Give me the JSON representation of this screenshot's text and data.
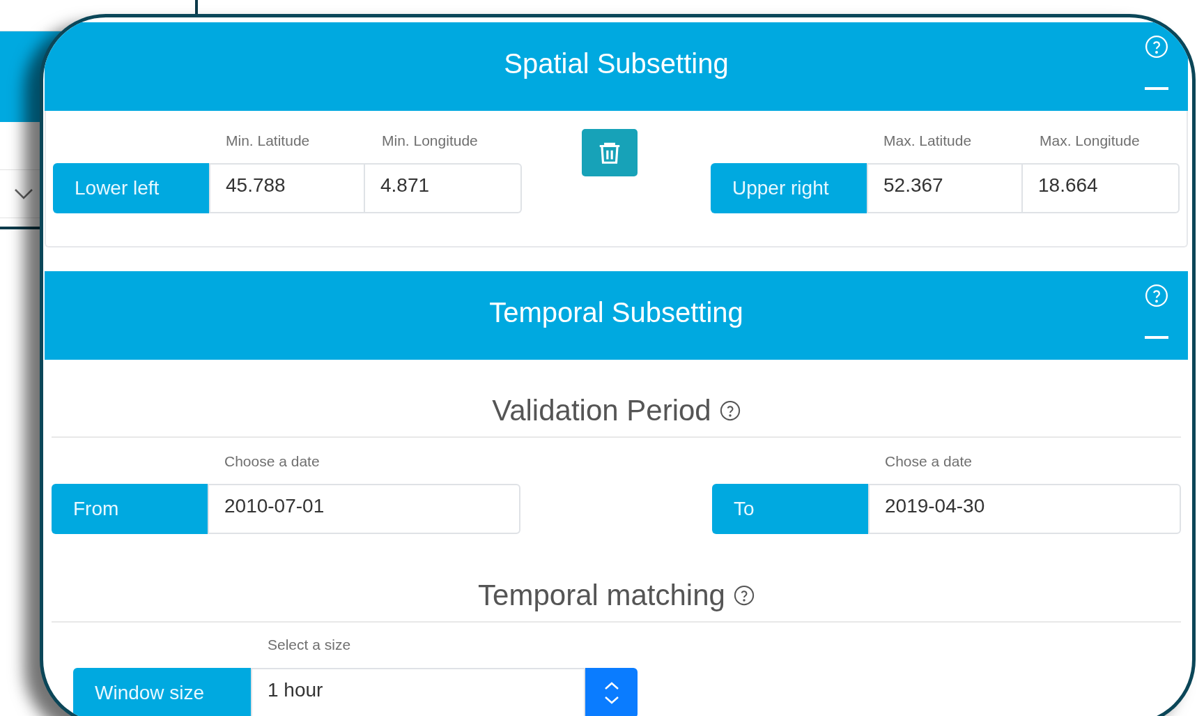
{
  "spatial_subsetting": {
    "title": "Spatial Subsetting",
    "corners": [
      {
        "label": "Lower left",
        "fields": [
          {
            "caption": "Min. Latitude",
            "value": "45.788"
          },
          {
            "caption": "Min. Longitude",
            "value": "4.871"
          }
        ]
      },
      {
        "label": "Upper right",
        "fields": [
          {
            "caption": "Max. Latitude",
            "value": "52.367"
          },
          {
            "caption": "Max. Longitude",
            "value": "18.664"
          }
        ]
      }
    ]
  },
  "temporal_subsetting": {
    "title": "Temporal Subsetting",
    "validation_period": {
      "heading": "Validation Period",
      "range": [
        {
          "label": "From",
          "caption": "Choose a date",
          "value": "2010-07-01"
        },
        {
          "label": "To",
          "caption": "Chose a date",
          "value": "2019-04-30"
        }
      ]
    },
    "temporal_matching": {
      "heading": "Temporal matching",
      "window_size": {
        "label": "Window size",
        "caption": "Select a size",
        "value": "1 hour"
      }
    }
  }
}
